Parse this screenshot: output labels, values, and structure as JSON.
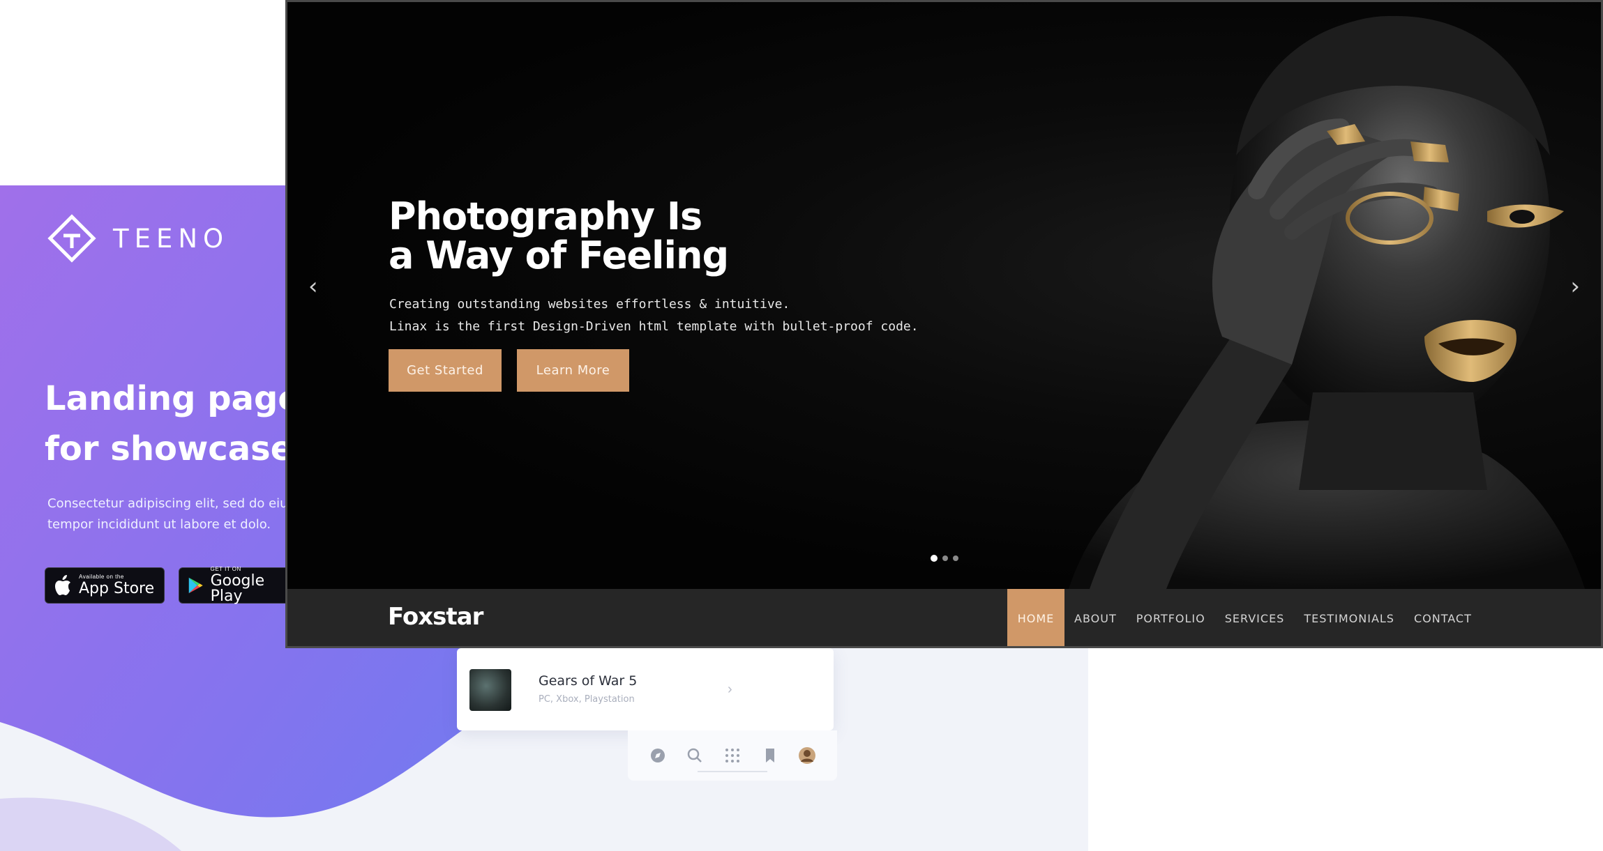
{
  "teeno": {
    "logo_text": "TEENO",
    "headline": "Landing page\nfor showcase",
    "description": "Consectetur adipiscing elit, sed do eiu\ntempor incididunt ut labore et dolo.",
    "app_store": {
      "small": "Available on the",
      "big": "App Store"
    },
    "google_play": {
      "small": "GET IT ON",
      "big": "Google Play"
    },
    "game_card": {
      "title": "Gears of War 5",
      "subtitle": "PC, Xbox, Playstation"
    },
    "bottom_bar_icons": [
      "compass-icon",
      "search-icon",
      "grid-icon",
      "bookmark-icon",
      "avatar"
    ]
  },
  "foxstar": {
    "hero": {
      "title_line1": "Photography Is",
      "title_line2": "a Way of Feeling",
      "subtitle_line1": "Creating outstanding websites effortless & intuitive.",
      "subtitle_line2": "Linax is the first Design-Driven html template with bullet-proof code.",
      "primary_cta": "Get Started",
      "secondary_cta": "Learn More",
      "prev_arrow": "‹",
      "next_arrow": "›",
      "slide_count": 3,
      "active_slide": 1
    },
    "brand": "Foxstar",
    "nav": [
      "HOME",
      "ABOUT",
      "PORTFOLIO",
      "SERVICES",
      "TESTIMONIALS",
      "CONTACT"
    ],
    "active_nav": "HOME"
  },
  "colors": {
    "accent": "#d09868",
    "nav_bg": "#262626",
    "teeno_gradient_start": "#a070ea",
    "teeno_gradient_end": "#6a7cf0"
  }
}
